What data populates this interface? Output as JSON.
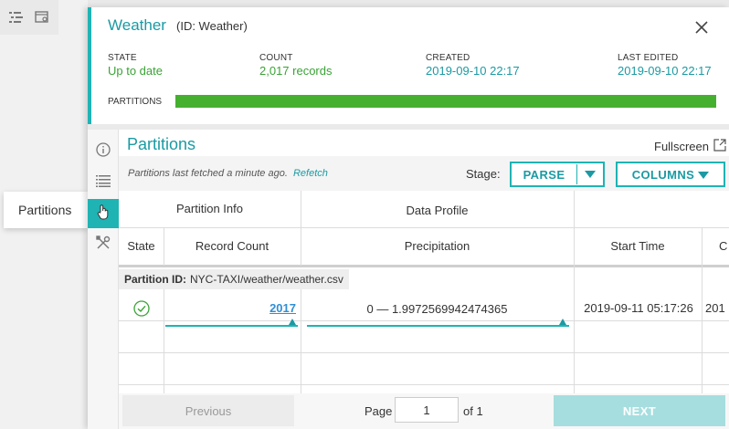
{
  "sidebar_tooltip": "Partitions",
  "header": {
    "title": "Weather",
    "id_label": "(ID: Weather)"
  },
  "stats": [
    {
      "label": "STATE",
      "value": "Up to date"
    },
    {
      "label": "COUNT",
      "value": "2,017 records"
    },
    {
      "label": "CREATED",
      "value": "2019-09-10 22:17"
    },
    {
      "label": "LAST EDITED",
      "value": "2019-09-10 22:17"
    }
  ],
  "partitions_bar": {
    "label": "PARTITIONS",
    "fill_percent": 100,
    "color": "#45b030"
  },
  "section": {
    "title": "Partitions",
    "fullscreen_label": "Fullscreen",
    "fetched_text": "Partitions last fetched a minute ago.",
    "refetch_label": "Refetch",
    "stage_label": "Stage:",
    "stage_value": "PARSE",
    "columns_label": "COLUMNS"
  },
  "table": {
    "group_headers": [
      "Partition Info",
      "Data Profile"
    ],
    "columns": [
      "State",
      "Record Count",
      "Precipitation",
      "Start Time",
      "C"
    ],
    "partition_label": "Partition ID:",
    "partition_id": "NYC-TAXI/weather/weather.csv",
    "row": {
      "record_count": "2017",
      "precipitation": "0 — 1.9972569942474365",
      "start_time": "2019-09-11 05:17:26",
      "cut": "201"
    }
  },
  "pagination": {
    "previous_label": "Previous",
    "page_label": "Page",
    "page_value": "1",
    "of_label": "of 1",
    "next_label": "NEXT"
  },
  "colors": {
    "accent": "#1fb3b3",
    "teal_text": "#1b9aa3",
    "success": "#3aa335",
    "link": "#2f8fd5"
  }
}
